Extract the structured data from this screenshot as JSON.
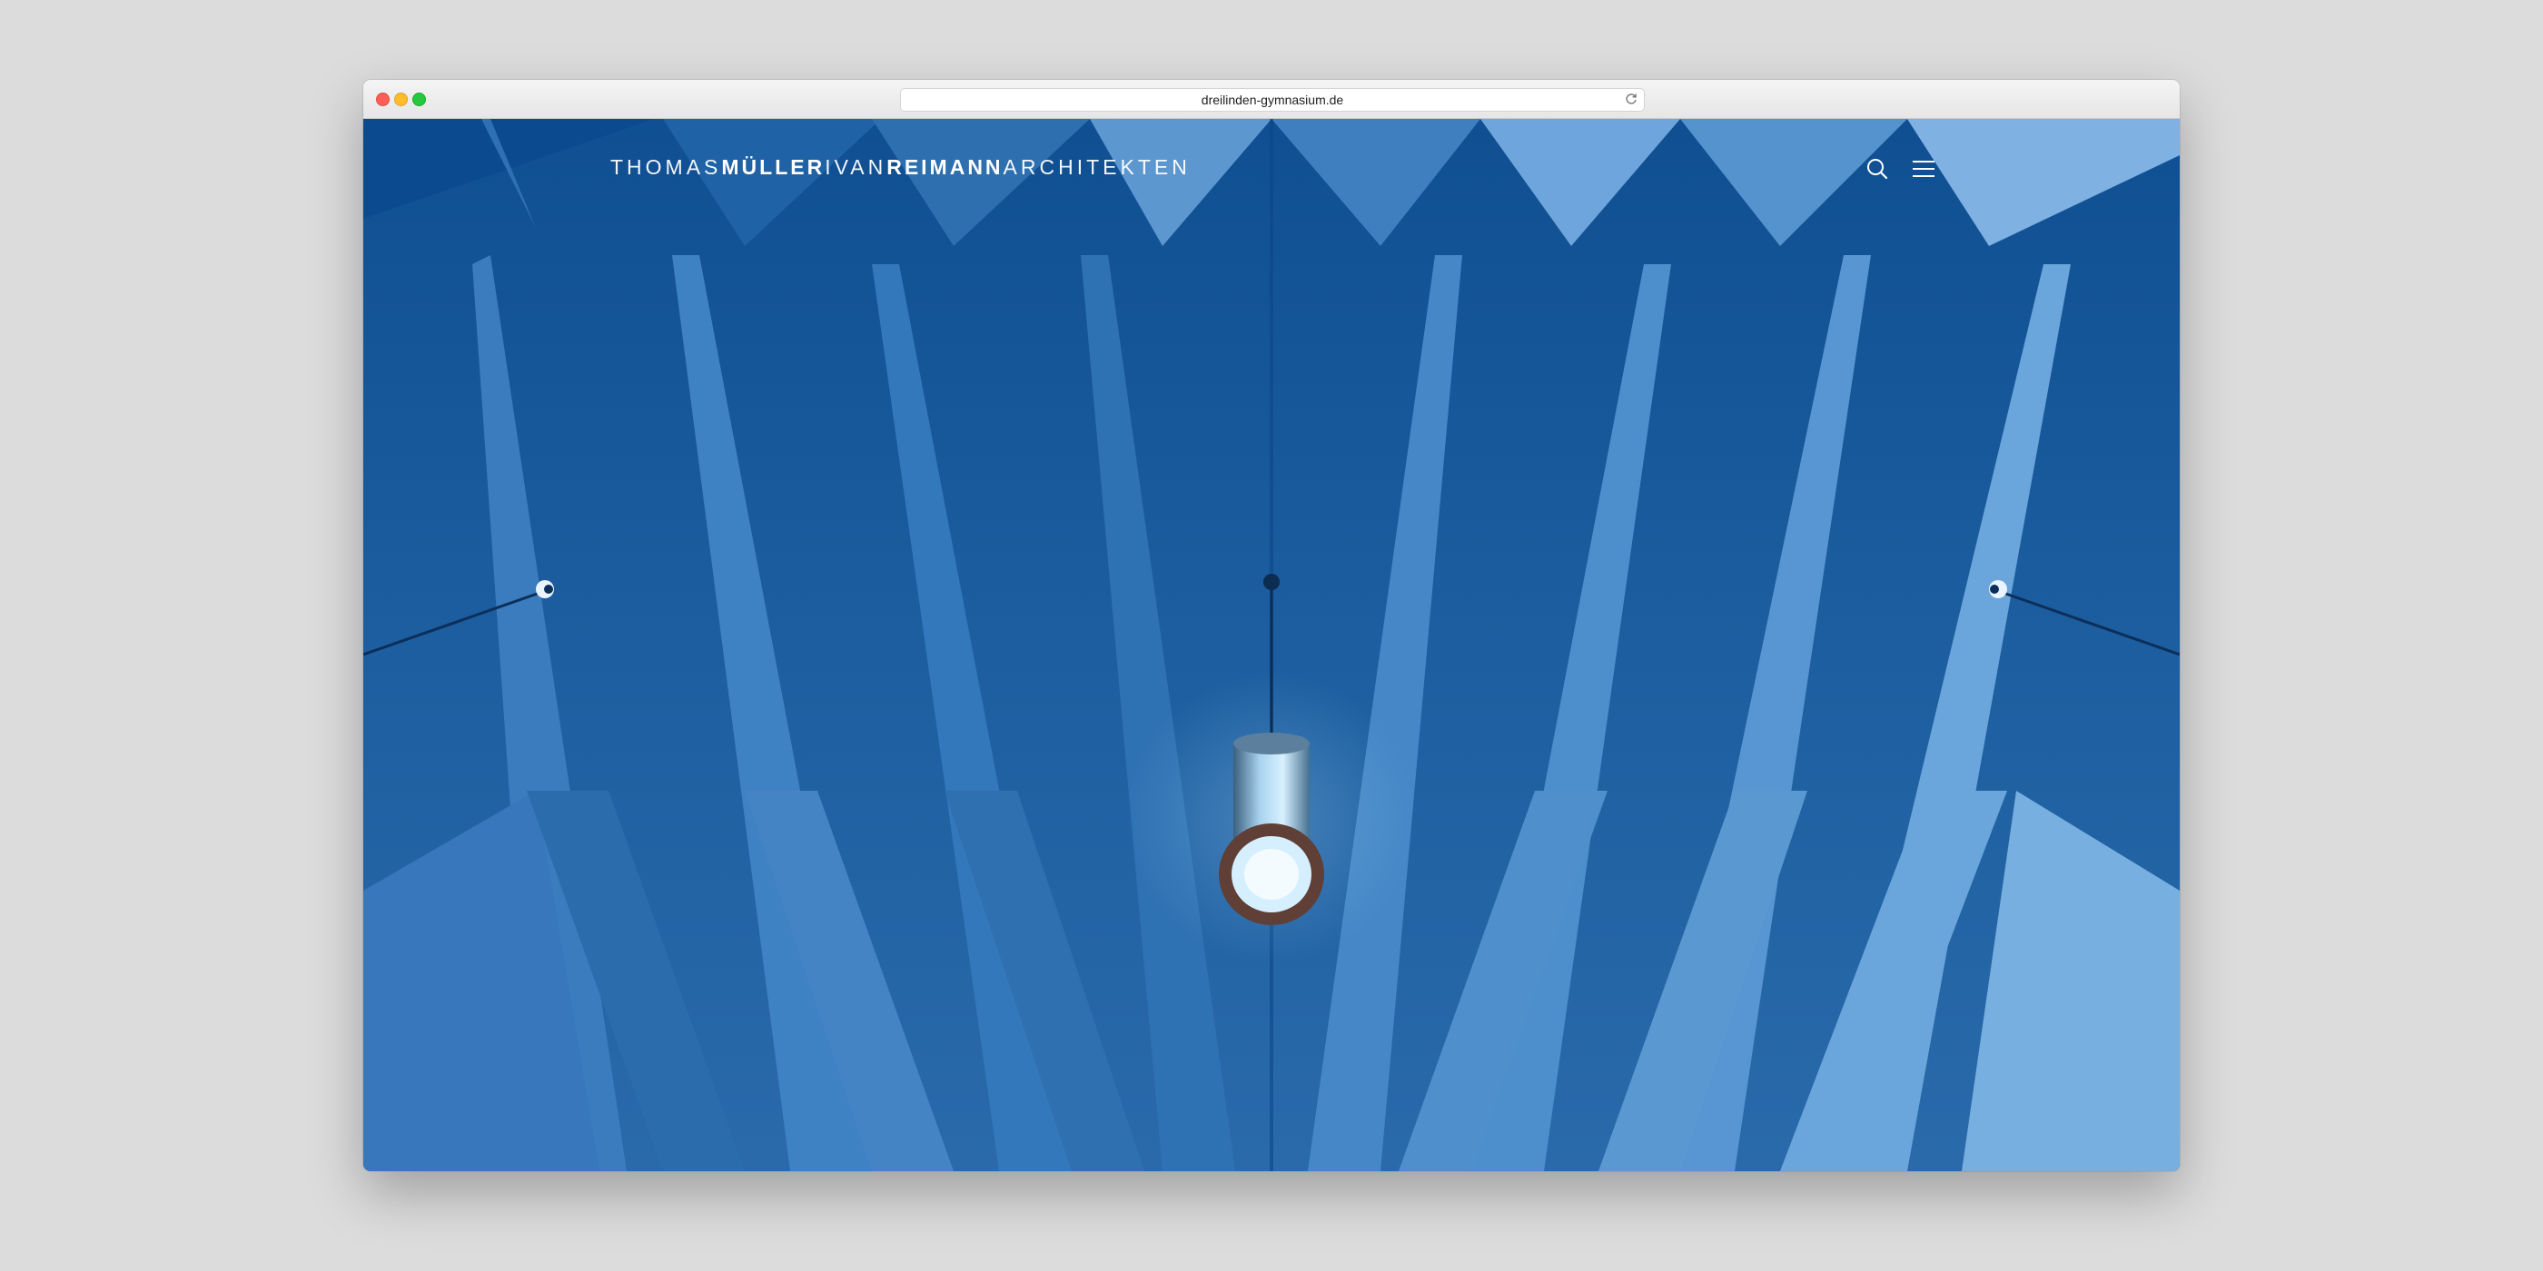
{
  "browser": {
    "url": "dreilinden-gymnasium.de"
  },
  "site": {
    "logo": {
      "part1": "THOMAS",
      "part2": "MÜLLER",
      "part3": "IVAN",
      "part4": "REIMANN",
      "part5": "ARCHITEKTEN"
    }
  },
  "icons": {
    "search": "search-icon",
    "menu": "hamburger-menu-icon",
    "reload": "reload-icon"
  },
  "colors": {
    "hero_dark": "#0d4f95",
    "hero_mid": "#2d6fb3",
    "hero_light": "#6ea5dc",
    "logo": "#ffffff"
  }
}
